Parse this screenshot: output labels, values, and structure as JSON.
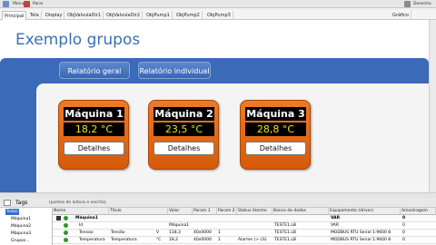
{
  "toolbar": {
    "menu": "Menu",
    "stop": "Parar",
    "design": "Desenho"
  },
  "tabs": [
    {
      "label": "Principal",
      "active": true
    },
    {
      "label": "Tela"
    },
    {
      "label": "Display"
    },
    {
      "label": "ObjValvulaDir1"
    },
    {
      "label": "ObjValvulaDir2"
    },
    {
      "label": "ObjPump1"
    },
    {
      "label": "ObjPump2"
    },
    {
      "label": "ObjPump3"
    },
    {
      "label": "Gráfico"
    }
  ],
  "page": {
    "title": "Exemplo grupos",
    "btn_general": "Relatório geral",
    "btn_individual": "Relatório individual",
    "colors": {
      "accent_blue": "#3a6ab8",
      "card_orange": "#e0661a",
      "value_yellow": "#f0e010"
    }
  },
  "machines": [
    {
      "name": "Máquina 1",
      "value": "18,2 °C",
      "button": "Detalhes"
    },
    {
      "name": "Máquina 2",
      "value": "23,5 °C",
      "button": "Detalhes"
    },
    {
      "name": "Máquina 3",
      "value": "28,8 °C",
      "button": "Detalhes"
    }
  ],
  "tags_panel": {
    "label": "Tags",
    "hint": "(pontos de leitura e escrita)",
    "tree": [
      "Todos",
      "Máquina1",
      "Máquina2",
      "Máquina3",
      "Grupos..."
    ],
    "columns": [
      "Nome",
      "Título",
      "Valor",
      "Param 1",
      "Param 2",
      "Status Alarme",
      "Banco de dados",
      "Equipamento (driver)",
      "Amostragem"
    ],
    "rows": [
      {
        "name": "Máquina1",
        "title": "",
        "unit": "",
        "value": "",
        "p1": "",
        "p2": "",
        "alarm": "",
        "db": "",
        "driver": "VAR",
        "sample": "0",
        "group": true
      },
      {
        "name": "Id",
        "title": "",
        "unit": "",
        "value": "Máquina1",
        "p1": "",
        "p2": "",
        "alarm": "",
        "db": "TESTE1.LB",
        "driver": "VAR",
        "sample": "0"
      },
      {
        "name": "Tensao",
        "title": "Tensão",
        "unit": "V",
        "value": "118,3",
        "p1": "40x0000",
        "p2": "1",
        "alarm": "",
        "db": "TESTE1.LB",
        "driver": "MODBUS RTU Serial 1:9600 8",
        "sample": "0"
      },
      {
        "name": "Temperatura",
        "title": "Temperatura",
        "unit": "°C",
        "value": "18,2",
        "p1": "40x0000",
        "p2": "1",
        "alarm": "Alarme (> LS)",
        "db": "TESTE1.LB",
        "driver": "MODBUS RTU Serial 1:9600 8",
        "sample": "0"
      }
    ]
  }
}
